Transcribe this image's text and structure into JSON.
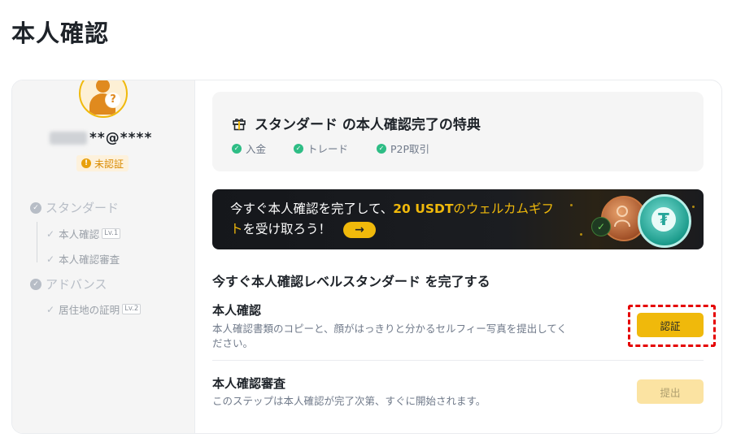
{
  "page": {
    "title": "本人確認"
  },
  "profile": {
    "masked_email": "**@****",
    "status": "未認証"
  },
  "sidebar": {
    "steps": [
      {
        "label": "スタンダード",
        "substeps": [
          {
            "label": "本人確認",
            "badge": "Lv.1"
          },
          {
            "label": "本人確認審査",
            "badge": ""
          }
        ]
      },
      {
        "label": "アドバンス",
        "substeps": [
          {
            "label": "居住地の証明",
            "badge": "Lv.2"
          }
        ]
      }
    ]
  },
  "benefits": {
    "title": "スタンダード の本人確認完了の特典",
    "items": [
      "入金",
      "トレード",
      "P2P取引"
    ]
  },
  "promo": {
    "text_before": "今すぐ本人確認を完了して、",
    "highlight": "20 USDT",
    "text_middle": "のウェルカムギフ",
    "text_middle2": "ト",
    "text_after": "を受け取ろう！",
    "arrow": "→",
    "colors": {
      "accent": "#f0b90b"
    }
  },
  "main": {
    "heading": "今すぐ本人確認レベルスタンダード を完了する",
    "tasks": [
      {
        "title": "本人確認",
        "description": "本人確認書類のコピーと、顔がはっきりと分かるセルフィー写真を提出してください。",
        "button": "認証"
      },
      {
        "title": "本人確認審査",
        "description": "このステップは本人確認が完了次第、すぐに開始されます。",
        "button": "提出"
      }
    ]
  }
}
